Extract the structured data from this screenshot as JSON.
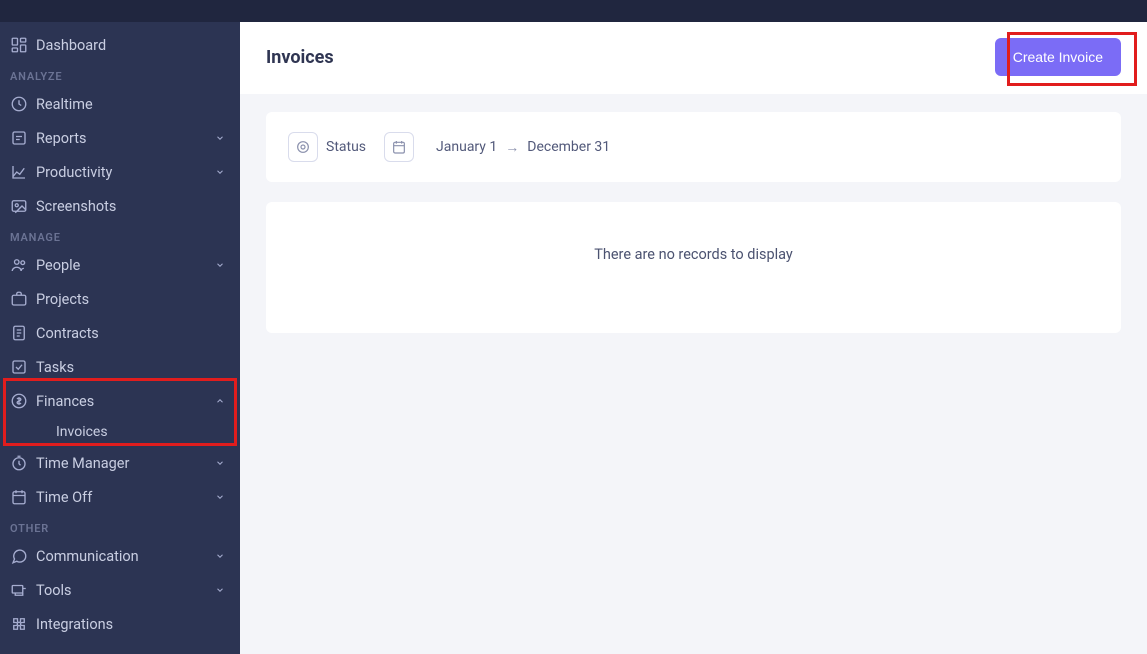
{
  "page": {
    "title": "Invoices"
  },
  "buttons": {
    "create_invoice": "Create Invoice"
  },
  "filters": {
    "status_label": "Status",
    "date_from": "January 1",
    "date_to": "December 31"
  },
  "empty_state": "There are no records to display",
  "sidebar": {
    "sections": {
      "analyze": "ANALYZE",
      "manage": "MANAGE",
      "other": "OTHER"
    },
    "items": {
      "dashboard": "Dashboard",
      "realtime": "Realtime",
      "reports": "Reports",
      "productivity": "Productivity",
      "screenshots": "Screenshots",
      "people": "People",
      "projects": "Projects",
      "contracts": "Contracts",
      "tasks": "Tasks",
      "finances": "Finances",
      "finances_sub_invoices": "Invoices",
      "time_manager": "Time Manager",
      "time_off": "Time Off",
      "communication": "Communication",
      "tools": "Tools",
      "integrations": "Integrations"
    }
  }
}
